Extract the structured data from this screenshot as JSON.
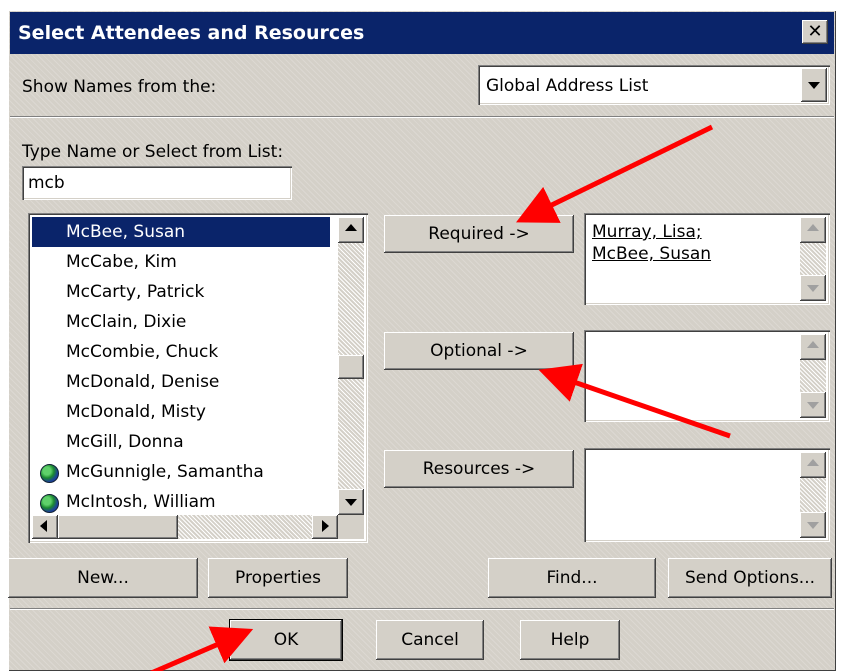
{
  "dialog": {
    "title": "Select Attendees and Resources",
    "close_glyph": "✕",
    "show_names_label": "Show Names from the:",
    "address_book": "Global Address List",
    "type_name_label": "Type Name or Select from List:",
    "search_value": "mcb"
  },
  "names_list": [
    {
      "name": "McBee, Susan",
      "selected": true,
      "icon": ""
    },
    {
      "name": "McCabe, Kim",
      "selected": false,
      "icon": ""
    },
    {
      "name": "McCarty, Patrick",
      "selected": false,
      "icon": ""
    },
    {
      "name": "McClain, Dixie",
      "selected": false,
      "icon": ""
    },
    {
      "name": "McCombie, Chuck",
      "selected": false,
      "icon": ""
    },
    {
      "name": "McDonald, Denise",
      "selected": false,
      "icon": ""
    },
    {
      "name": "McDonald, Misty",
      "selected": false,
      "icon": ""
    },
    {
      "name": "McGill, Donna",
      "selected": false,
      "icon": ""
    },
    {
      "name": "McGunnigle, Samantha",
      "selected": false,
      "icon": "globe-icon"
    },
    {
      "name": "McIntosh, William",
      "selected": false,
      "icon": "globe-icon"
    }
  ],
  "buttons": {
    "required": "Required ->",
    "optional": "Optional ->",
    "resources": "Resources ->",
    "new": "New...",
    "properties": "Properties",
    "find": "Find...",
    "send_options": "Send Options...",
    "ok": "OK",
    "cancel": "Cancel",
    "help": "Help"
  },
  "recipients": {
    "required": [
      "Murray, Lisa;",
      "McBee, Susan"
    ],
    "optional": [],
    "resources": []
  },
  "colors": {
    "title_bar": "#0a246a",
    "dialog_face": "#d4d0c8",
    "selection": "#0a246a",
    "annotation_arrow": "#ff0000"
  }
}
